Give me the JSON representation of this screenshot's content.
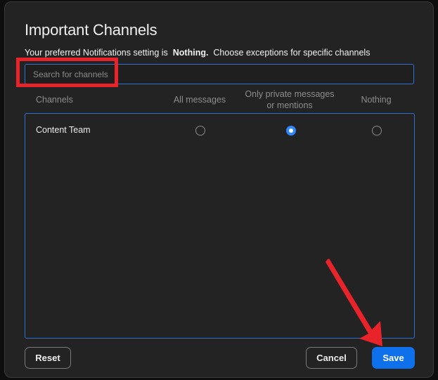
{
  "dialog": {
    "title": "Important Channels",
    "subtitle_prefix": "Your preferred Notifications setting is",
    "subtitle_value": "Nothing.",
    "subtitle_suffix": "Choose exceptions for specific channels"
  },
  "search": {
    "placeholder": "Search for channels",
    "value": ""
  },
  "table": {
    "headers": {
      "channels": "Channels",
      "all_messages": "All messages",
      "private_line1": "Only private messages",
      "private_line2": "or mentions",
      "nothing": "Nothing"
    },
    "rows": [
      {
        "name": "Content Team",
        "selected": "private"
      }
    ]
  },
  "buttons": {
    "reset": "Reset",
    "cancel": "Cancel",
    "save": "Save"
  },
  "colors": {
    "accent": "#0e71eb",
    "highlight": "#e8232a",
    "radio_selected": "#2f86ff"
  }
}
